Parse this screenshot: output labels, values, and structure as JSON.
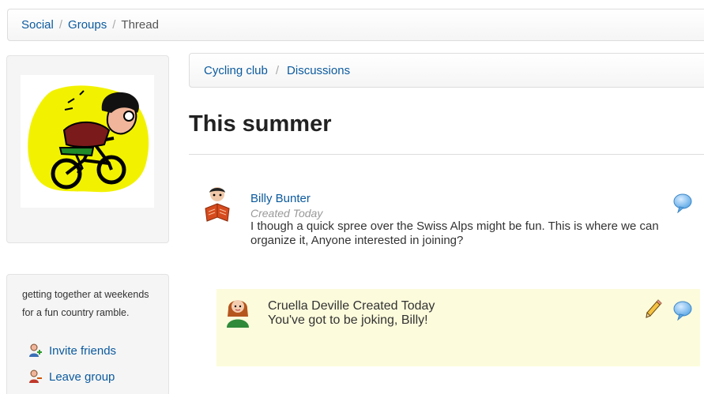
{
  "breadcrumb": {
    "items": [
      "Social",
      "Groups"
    ],
    "current": "Thread",
    "separator": "/"
  },
  "group": {
    "description": "getting together at weekends for a fun country ramble.",
    "actions": {
      "invite": "Invite friends",
      "leave": "Leave group"
    }
  },
  "group_breadcrumb": {
    "items": [
      "Cycling club",
      "Discussions"
    ],
    "separator": "/"
  },
  "thread": {
    "title": "This summer",
    "post": {
      "author": "Billy Bunter",
      "meta": "Created Today",
      "body": " I though a quick spree over the Swiss Alps might be fun. This is where we can organize it, Anyone interested in joining?"
    },
    "reply": {
      "author": "Cruella Deville",
      "meta": "Created Today",
      "body": " You've got to be joking, Billy!"
    }
  },
  "icons": {
    "group_avatar": "cyclist-cartoon-icon",
    "post_avatar": "reader-avatar-icon",
    "reply_avatar": "woman-avatar-icon",
    "comment": "speech-bubble-icon",
    "edit": "pencil-icon",
    "invite": "add-user-icon",
    "leave": "leave-user-icon"
  },
  "colors": {
    "link": "#0b5a9e",
    "reply_background": "#fcfbdc",
    "panel_background": "#f5f5f5",
    "blob_yellow": "#f2f200"
  }
}
